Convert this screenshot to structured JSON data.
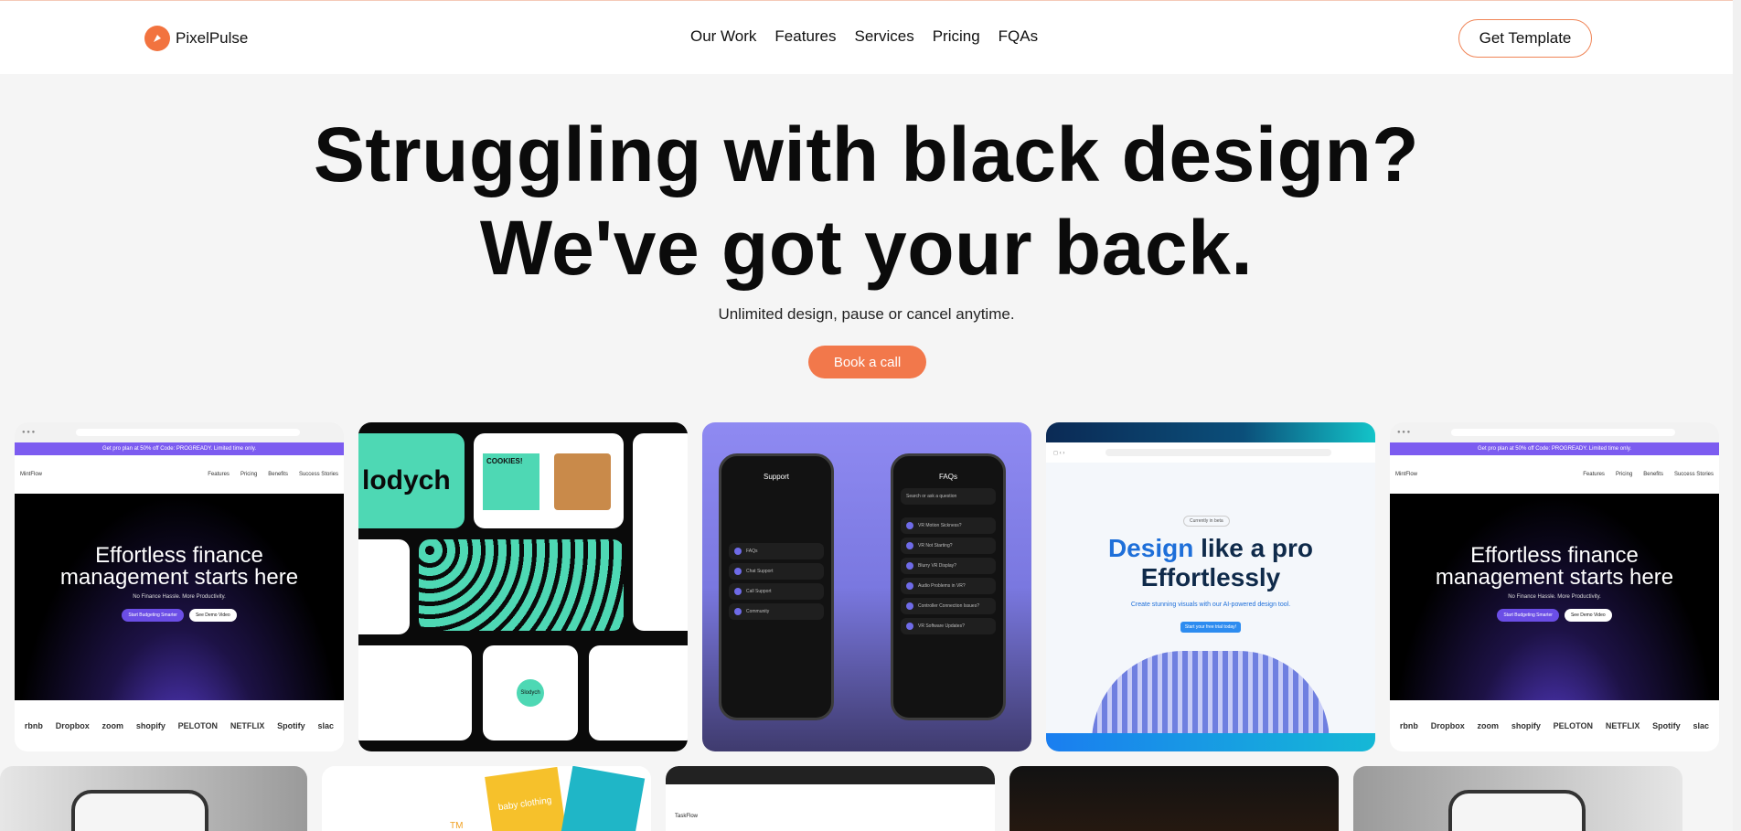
{
  "brand": {
    "name": "PixelPulse",
    "accent": "#f2784b"
  },
  "nav": {
    "items": [
      "Our Work",
      "Features",
      "Services",
      "Pricing",
      "FQAs"
    ]
  },
  "header": {
    "cta_label": "Get Template"
  },
  "hero": {
    "title_line1": "Struggling with black design?",
    "title_line2": "We've got your back.",
    "subtitle": "Unlimited design, pause or cancel anytime.",
    "button_label": "Book a call"
  },
  "showcase": {
    "finance": {
      "promo": "Get pro plan at 50% off Code: PROGREADY. Limited time only.",
      "app_name": "MintFlow",
      "links": [
        "Features",
        "Pricing",
        "Benefits",
        "Success Stories"
      ],
      "title_line1": "Effortless finance",
      "title_line2": "management starts here",
      "subtitle": "No Finance Hassle. More Productivity.",
      "btn_primary": "Start Budgeting Smarter",
      "btn_secondary": "See Demo Video",
      "brands": [
        "rbnb",
        "Dropbox",
        "zoom",
        "shopify",
        "PELOTON",
        "NETFLIX",
        "Spotify",
        "slac"
      ]
    },
    "cookies": {
      "brand": "lodych",
      "tag": "COOKIES!",
      "sticker": "Slodych"
    },
    "phones": {
      "support_title": "Support",
      "support_items": [
        "FAQs",
        "Chat Support",
        "Call Support",
        "Community"
      ],
      "faq_title": "FAQs",
      "faq_search": "Search or ask a question",
      "faq_items": [
        "VR Motion Sickness?",
        "VR Not Starting?",
        "Blurry VR Display?",
        "Audio Problems in VR?",
        "Controller Connection Issues?",
        "VR Software Updates?"
      ]
    },
    "design": {
      "badge": "Currently in beta",
      "title_blue": "Design",
      "title_rest": " like a pro",
      "title_line2": "Effortlessly",
      "subtitle": "Create stunning visuals with our AI-powered design tool.",
      "button": "Start your free trial today!"
    },
    "row2": {
      "taskflow": "TaskFlow",
      "clothing": "baby clothing",
      "tm": "TM"
    }
  }
}
